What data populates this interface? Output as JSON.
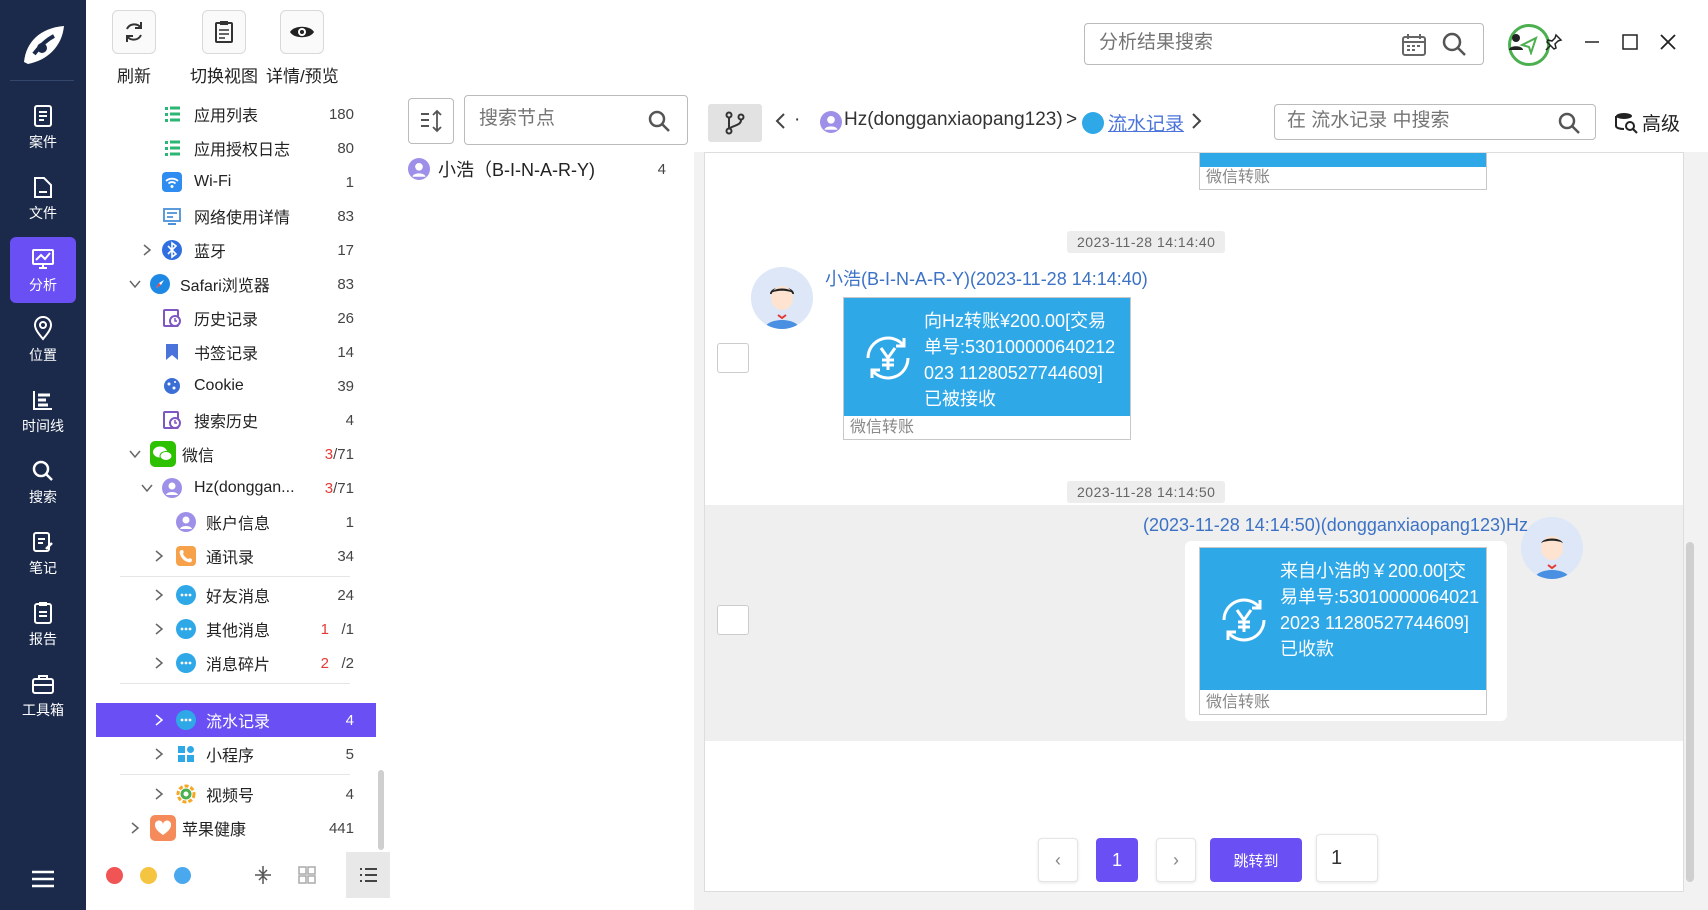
{
  "rail": {
    "items": [
      {
        "label": "案件",
        "icon": "case-icon"
      },
      {
        "label": "文件",
        "icon": "file-icon"
      },
      {
        "label": "分析",
        "icon": "analysis-icon",
        "active": true
      },
      {
        "label": "位置",
        "icon": "location-icon"
      },
      {
        "label": "时间线",
        "icon": "timeline-icon"
      },
      {
        "label": "搜索",
        "icon": "search-icon"
      },
      {
        "label": "笔记",
        "icon": "note-icon"
      },
      {
        "label": "报告",
        "icon": "report-icon"
      },
      {
        "label": "工具箱",
        "icon": "toolbox-icon"
      }
    ]
  },
  "toolbar": {
    "refresh": "刷新",
    "switch_view": "切换视图",
    "details": "详情/预览",
    "search_placeholder": "分析结果搜索"
  },
  "tree": {
    "rows": [
      {
        "label": "应用列表",
        "count": "180"
      },
      {
        "label": "应用授权日志",
        "count": "80"
      },
      {
        "label": "Wi-Fi",
        "count": "1"
      },
      {
        "label": "网络使用详情",
        "count": "83"
      },
      {
        "label": "蓝牙",
        "count": "17"
      },
      {
        "label": "Safari浏览器",
        "count": "83"
      },
      {
        "label": "历史记录",
        "count": "26"
      },
      {
        "label": "书签记录",
        "count": "14"
      },
      {
        "label": "Cookie",
        "count": "39"
      },
      {
        "label": "搜索历史",
        "count": "4"
      },
      {
        "label": "微信",
        "count_red": "3",
        "count": "/71"
      },
      {
        "label": "Hz(donggan...",
        "count_red": "3",
        "count": "/71"
      },
      {
        "label": "账户信息",
        "count": "1"
      },
      {
        "label": "通讯录",
        "count": "34"
      },
      {
        "label": "好友消息",
        "count": "24"
      },
      {
        "label": "其他消息",
        "count_red": "1",
        "count": "/1"
      },
      {
        "label": "消息碎片",
        "count_red": "2",
        "count": "/2"
      },
      {
        "label": "流水记录",
        "count": "4"
      },
      {
        "label": "小程序",
        "count": "5"
      },
      {
        "label": "视频号",
        "count": "4"
      },
      {
        "label": "苹果健康",
        "count": "441"
      }
    ],
    "footer_dots": [
      "#f05454",
      "#f5c542",
      "#4aa8ee"
    ]
  },
  "nodes": {
    "search_placeholder": "搜索节点",
    "items": [
      {
        "label": "小浩（B-I-N-A-R-Y)",
        "count": "4"
      }
    ]
  },
  "chat": {
    "breadcrumb": {
      "dot": "·",
      "account": "Hz(dongganxiaopang123)",
      "sep": ">",
      "current": "流水记录"
    },
    "search_placeholder": "在 流水记录 中搜索",
    "advanced": "高级",
    "top_card_footer": "微信转账",
    "messages": [
      {
        "timestamp": "2023-11-28 14:14:40",
        "sender": "小浩(B-I-N-A-R-Y)(2023-11-28 14:14:40)",
        "text": "向Hz转账¥200.00[交易单号:530100000640212023 11280527744609]",
        "status": "已被接收",
        "footer": "微信转账"
      },
      {
        "timestamp": "2023-11-28 14:14:50",
        "sender": "(2023-11-28 14:14:50)(dongganxiaopang123)Hz",
        "text": "来自小浩的￥200.00[交易单号:530100000640212023 11280527744609]",
        "status": "已收款",
        "footer": "微信转账"
      }
    ],
    "pagination": {
      "prev": "‹",
      "current": "1",
      "next": "›",
      "jump": "跳转到",
      "jump_value": "1"
    }
  },
  "colors": {
    "rail_bg": "#1b2a4b",
    "accent": "#6a4ff5",
    "transfer_blue": "#2fa8e8",
    "link_blue": "#3b72c6"
  }
}
